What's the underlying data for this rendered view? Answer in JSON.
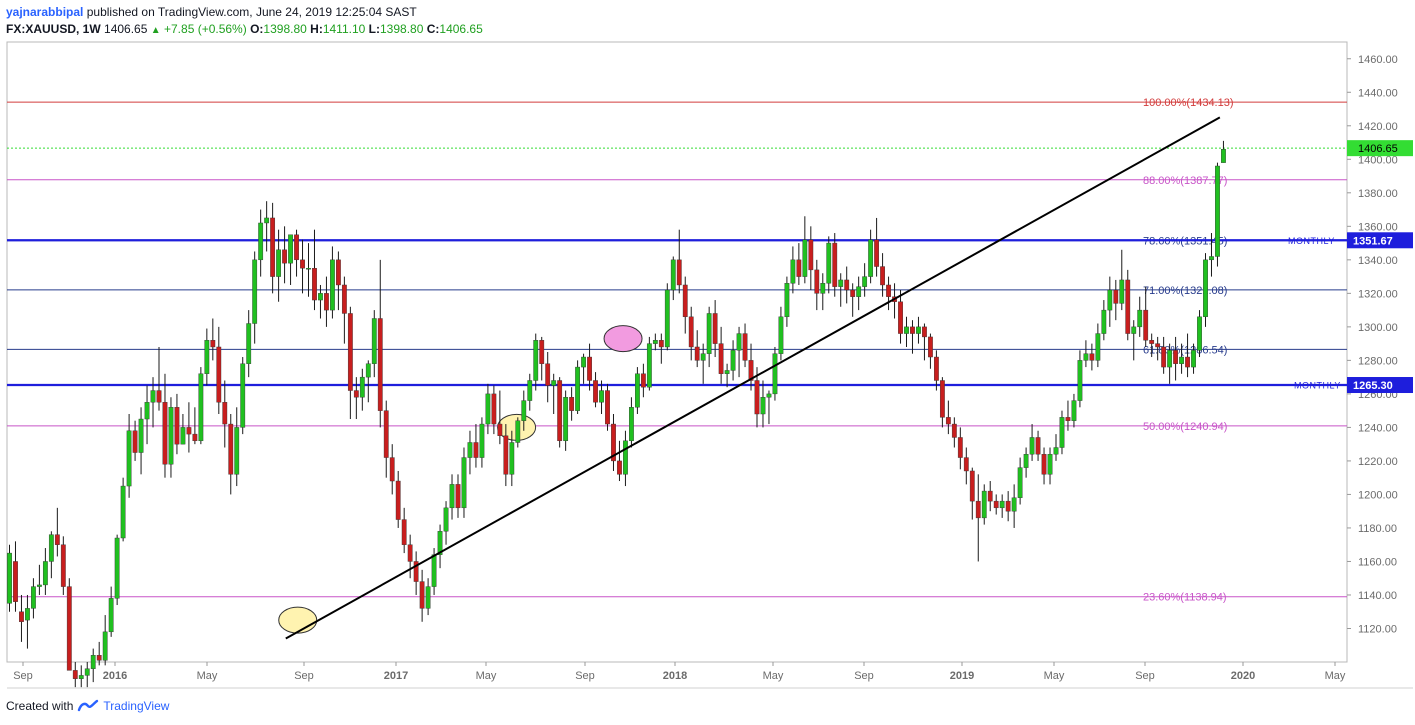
{
  "header": {
    "author": "yajnarabbipal",
    "published_text": "published on TradingView.com, June 24, 2019 12:25:04 SAST",
    "symbol": "FX:XAUUSD, 1W",
    "last": "1406.65",
    "change": "+7.85 (+0.56%)",
    "o_label": "O:",
    "o_value": "1398.80",
    "h_label": "H:",
    "h_value": "1411.10",
    "l_label": "L:",
    "l_value": "1398.80",
    "c_label": "C:",
    "c_value": "1406.65"
  },
  "footer": {
    "created_with": "Created with",
    "brand": "TradingView"
  },
  "colors": {
    "up": "#20c020",
    "down": "#c81e1e",
    "wick": "#1a1a1a",
    "fib_red": "#d23c3c",
    "fib_magenta": "#c855c8",
    "fib_navy": "#283c8c",
    "monthly_blue": "#1e1edc",
    "price_green": "#33dd33",
    "trend": "#000000"
  },
  "chart_data": {
    "type": "candlestick",
    "symbol": "FX:XAUUSD",
    "interval": "1W",
    "ylim": [
      1100,
      1470
    ],
    "y_ticks": [
      1120,
      1140,
      1160,
      1180,
      1200,
      1220,
      1240,
      1260,
      1280,
      1300,
      1320,
      1340,
      1360,
      1380,
      1400,
      1420,
      1440,
      1460
    ],
    "x_ticks": [
      "Sep",
      "2016",
      "May",
      "Sep",
      "2017",
      "May",
      "Sep",
      "2018",
      "May",
      "Sep",
      "2019",
      "May",
      "Sep",
      "2020",
      "May"
    ],
    "fib_levels": [
      {
        "label": "100.00%(1434.13)",
        "value": 1434.13,
        "color": "fib_red"
      },
      {
        "label": "88.00%(1387.77)",
        "value": 1387.77,
        "color": "fib_magenta"
      },
      {
        "label": "78.60%(1351.45)",
        "value": 1351.45,
        "color": "fib_navy"
      },
      {
        "label": "71.00%(1322.08)",
        "value": 1322.08,
        "color": "fib_navy"
      },
      {
        "label": "61.80%(1286.54)",
        "value": 1286.54,
        "color": "fib_navy"
      },
      {
        "label": "50.00%(1240.94)",
        "value": 1240.94,
        "color": "fib_magenta"
      },
      {
        "label": "23.60%(1138.94)",
        "value": 1138.94,
        "color": "fib_magenta"
      }
    ],
    "monthly_levels": [
      {
        "label": "MONTHLY",
        "value": 1351.67,
        "badge": "1351.67"
      },
      {
        "label": "MONTHLY",
        "value": 1265.3,
        "badge": "1265.30"
      }
    ],
    "current_price": {
      "value": 1406.65,
      "label": "1406.65"
    },
    "trendline": {
      "from": {
        "week": 46.2,
        "price": 1114
      },
      "to": {
        "week": 202.4,
        "price": 1425
      }
    },
    "ellipses": [
      {
        "week": 48.2,
        "price": 1125,
        "color": "#fff3b0"
      },
      {
        "week": 84.8,
        "price": 1240,
        "color": "#fff3b0"
      },
      {
        "week": 102.6,
        "price": 1293,
        "color": "#f29be0"
      }
    ],
    "candles": [
      [
        1135,
        1170,
        1130,
        1165
      ],
      [
        1160,
        1172,
        1130,
        1136
      ],
      [
        1130,
        1140,
        1112,
        1124
      ],
      [
        1125,
        1140,
        1108,
        1132
      ],
      [
        1132,
        1150,
        1126,
        1145
      ],
      [
        1145,
        1158,
        1140,
        1146
      ],
      [
        1146,
        1168,
        1140,
        1160
      ],
      [
        1160,
        1178,
        1150,
        1176
      ],
      [
        1176,
        1192,
        1163,
        1170
      ],
      [
        1170,
        1175,
        1140,
        1145
      ],
      [
        1145,
        1150,
        1100,
        1095
      ],
      [
        1095,
        1100,
        1085,
        1090
      ],
      [
        1090,
        1098,
        1085,
        1092
      ],
      [
        1092,
        1100,
        1085,
        1096
      ],
      [
        1096,
        1108,
        1088,
        1104
      ],
      [
        1104,
        1112,
        1098,
        1101
      ],
      [
        1101,
        1128,
        1098,
        1118
      ],
      [
        1118,
        1145,
        1115,
        1138
      ],
      [
        1138,
        1176,
        1134,
        1174
      ],
      [
        1174,
        1210,
        1172,
        1205
      ],
      [
        1205,
        1248,
        1198,
        1238
      ],
      [
        1238,
        1244,
        1220,
        1225
      ],
      [
        1225,
        1252,
        1212,
        1245
      ],
      [
        1245,
        1265,
        1230,
        1255
      ],
      [
        1255,
        1270,
        1240,
        1262
      ],
      [
        1262,
        1288,
        1250,
        1255
      ],
      [
        1255,
        1272,
        1210,
        1218
      ],
      [
        1218,
        1258,
        1210,
        1252
      ],
      [
        1252,
        1260,
        1224,
        1230
      ],
      [
        1230,
        1248,
        1230,
        1240
      ],
      [
        1240,
        1255,
        1225,
        1236
      ],
      [
        1236,
        1252,
        1230,
        1232
      ],
      [
        1232,
        1276,
        1230,
        1272
      ],
      [
        1272,
        1299,
        1265,
        1292
      ],
      [
        1292,
        1305,
        1280,
        1288
      ],
      [
        1288,
        1300,
        1248,
        1255
      ],
      [
        1255,
        1268,
        1228,
        1242
      ],
      [
        1242,
        1248,
        1200,
        1212
      ],
      [
        1212,
        1252,
        1205,
        1240
      ],
      [
        1240,
        1282,
        1236,
        1278
      ],
      [
        1278,
        1310,
        1270,
        1302
      ],
      [
        1302,
        1345,
        1290,
        1340
      ],
      [
        1340,
        1370,
        1330,
        1362
      ],
      [
        1362,
        1375,
        1345,
        1365
      ],
      [
        1365,
        1374,
        1320,
        1330
      ],
      [
        1330,
        1358,
        1315,
        1346
      ],
      [
        1346,
        1360,
        1326,
        1338
      ],
      [
        1338,
        1350,
        1325,
        1355
      ],
      [
        1355,
        1358,
        1330,
        1340
      ],
      [
        1340,
        1352,
        1320,
        1335
      ],
      [
        1335,
        1350,
        1318,
        1335
      ],
      [
        1335,
        1358,
        1310,
        1316
      ],
      [
        1316,
        1325,
        1305,
        1320
      ],
      [
        1320,
        1330,
        1300,
        1310
      ],
      [
        1310,
        1348,
        1305,
        1340
      ],
      [
        1340,
        1345,
        1310,
        1325
      ],
      [
        1325,
        1330,
        1290,
        1308
      ],
      [
        1308,
        1312,
        1245,
        1262
      ],
      [
        1262,
        1270,
        1245,
        1258
      ],
      [
        1258,
        1275,
        1250,
        1270
      ],
      [
        1270,
        1280,
        1255,
        1278
      ],
      [
        1278,
        1310,
        1270,
        1305
      ],
      [
        1305,
        1340,
        1240,
        1250
      ],
      [
        1250,
        1256,
        1210,
        1222
      ],
      [
        1222,
        1230,
        1200,
        1208
      ],
      [
        1208,
        1214,
        1180,
        1185
      ],
      [
        1185,
        1192,
        1165,
        1170
      ],
      [
        1170,
        1176,
        1150,
        1160
      ],
      [
        1160,
        1166,
        1140,
        1148
      ],
      [
        1148,
        1155,
        1124,
        1132
      ],
      [
        1132,
        1150,
        1128,
        1145
      ],
      [
        1145,
        1168,
        1140,
        1164
      ],
      [
        1164,
        1182,
        1156,
        1178
      ],
      [
        1178,
        1196,
        1170,
        1192
      ],
      [
        1192,
        1212,
        1185,
        1206
      ],
      [
        1206,
        1212,
        1186,
        1192
      ],
      [
        1192,
        1228,
        1186,
        1222
      ],
      [
        1222,
        1238,
        1212,
        1231
      ],
      [
        1231,
        1242,
        1216,
        1222
      ],
      [
        1222,
        1246,
        1216,
        1242
      ],
      [
        1242,
        1266,
        1236,
        1260
      ],
      [
        1260,
        1265,
        1236,
        1242
      ],
      [
        1242,
        1262,
        1230,
        1235
      ],
      [
        1235,
        1242,
        1205,
        1212
      ],
      [
        1212,
        1238,
        1205,
        1231
      ],
      [
        1231,
        1246,
        1228,
        1244
      ],
      [
        1244,
        1262,
        1238,
        1256
      ],
      [
        1256,
        1272,
        1250,
        1268
      ],
      [
        1268,
        1296,
        1262,
        1292
      ],
      [
        1292,
        1294,
        1268,
        1278
      ],
      [
        1278,
        1285,
        1255,
        1265
      ],
      [
        1265,
        1272,
        1248,
        1268
      ],
      [
        1268,
        1270,
        1228,
        1232
      ],
      [
        1232,
        1262,
        1226,
        1258
      ],
      [
        1258,
        1264,
        1244,
        1250
      ],
      [
        1250,
        1280,
        1248,
        1276
      ],
      [
        1276,
        1284,
        1266,
        1282
      ],
      [
        1282,
        1290,
        1262,
        1268
      ],
      [
        1268,
        1273,
        1252,
        1255
      ],
      [
        1255,
        1268,
        1248,
        1262
      ],
      [
        1262,
        1266,
        1238,
        1242
      ],
      [
        1242,
        1248,
        1214,
        1220
      ],
      [
        1220,
        1232,
        1208,
        1212
      ],
      [
        1212,
        1238,
        1205,
        1232
      ],
      [
        1232,
        1258,
        1228,
        1252
      ],
      [
        1252,
        1276,
        1248,
        1272
      ],
      [
        1272,
        1278,
        1258,
        1264
      ],
      [
        1264,
        1294,
        1262,
        1290
      ],
      [
        1290,
        1296,
        1286,
        1292
      ],
      [
        1292,
        1296,
        1278,
        1288
      ],
      [
        1288,
        1326,
        1286,
        1322
      ],
      [
        1322,
        1342,
        1316,
        1340
      ],
      [
        1340,
        1358,
        1320,
        1325
      ],
      [
        1325,
        1330,
        1296,
        1306
      ],
      [
        1306,
        1312,
        1280,
        1288
      ],
      [
        1288,
        1298,
        1276,
        1280
      ],
      [
        1280,
        1290,
        1266,
        1284
      ],
      [
        1284,
        1312,
        1276,
        1308
      ],
      [
        1308,
        1316,
        1282,
        1290
      ],
      [
        1290,
        1300,
        1266,
        1272
      ],
      [
        1272,
        1278,
        1264,
        1274
      ],
      [
        1274,
        1292,
        1268,
        1286
      ],
      [
        1286,
        1300,
        1270,
        1296
      ],
      [
        1296,
        1302,
        1276,
        1280
      ],
      [
        1280,
        1290,
        1262,
        1268
      ],
      [
        1268,
        1276,
        1240,
        1248
      ],
      [
        1248,
        1268,
        1240,
        1258
      ],
      [
        1258,
        1262,
        1242,
        1260
      ],
      [
        1260,
        1288,
        1256,
        1284
      ],
      [
        1284,
        1312,
        1280,
        1306
      ],
      [
        1306,
        1330,
        1300,
        1326
      ],
      [
        1326,
        1348,
        1320,
        1340
      ],
      [
        1340,
        1350,
        1325,
        1330
      ],
      [
        1330,
        1366,
        1326,
        1352
      ],
      [
        1352,
        1360,
        1322,
        1334
      ],
      [
        1334,
        1340,
        1310,
        1320
      ],
      [
        1320,
        1332,
        1310,
        1326
      ],
      [
        1326,
        1354,
        1320,
        1350
      ],
      [
        1350,
        1356,
        1318,
        1324
      ],
      [
        1324,
        1332,
        1312,
        1328
      ],
      [
        1328,
        1336,
        1314,
        1322
      ],
      [
        1322,
        1326,
        1306,
        1318
      ],
      [
        1318,
        1330,
        1310,
        1324
      ],
      [
        1324,
        1338,
        1318,
        1330
      ],
      [
        1330,
        1358,
        1326,
        1352
      ],
      [
        1352,
        1365,
        1330,
        1336
      ],
      [
        1336,
        1344,
        1318,
        1325
      ],
      [
        1325,
        1330,
        1310,
        1318
      ],
      [
        1318,
        1326,
        1305,
        1315
      ],
      [
        1315,
        1322,
        1290,
        1296
      ],
      [
        1296,
        1306,
        1288,
        1300
      ],
      [
        1300,
        1304,
        1284,
        1296
      ],
      [
        1296,
        1306,
        1290,
        1300
      ],
      [
        1300,
        1302,
        1280,
        1294
      ],
      [
        1294,
        1296,
        1275,
        1282
      ],
      [
        1282,
        1286,
        1262,
        1268
      ],
      [
        1268,
        1270,
        1240,
        1246
      ],
      [
        1246,
        1256,
        1236,
        1242
      ],
      [
        1242,
        1246,
        1228,
        1234
      ],
      [
        1234,
        1240,
        1215,
        1222
      ],
      [
        1222,
        1228,
        1206,
        1214
      ],
      [
        1214,
        1216,
        1185,
        1196
      ],
      [
        1196,
        1212,
        1160,
        1186
      ],
      [
        1186,
        1206,
        1182,
        1202
      ],
      [
        1202,
        1208,
        1190,
        1196
      ],
      [
        1196,
        1200,
        1188,
        1192
      ],
      [
        1192,
        1200,
        1186,
        1196
      ],
      [
        1196,
        1202,
        1184,
        1190
      ],
      [
        1190,
        1206,
        1180,
        1198
      ],
      [
        1198,
        1222,
        1194,
        1216
      ],
      [
        1216,
        1228,
        1210,
        1224
      ],
      [
        1224,
        1242,
        1220,
        1234
      ],
      [
        1234,
        1238,
        1220,
        1224
      ],
      [
        1224,
        1228,
        1206,
        1212
      ],
      [
        1212,
        1228,
        1206,
        1224
      ],
      [
        1224,
        1236,
        1220,
        1228
      ],
      [
        1228,
        1250,
        1224,
        1246
      ],
      [
        1246,
        1256,
        1238,
        1244
      ],
      [
        1244,
        1260,
        1240,
        1256
      ],
      [
        1256,
        1286,
        1252,
        1280
      ],
      [
        1280,
        1292,
        1276,
        1284
      ],
      [
        1284,
        1290,
        1274,
        1280
      ],
      [
        1280,
        1302,
        1276,
        1296
      ],
      [
        1296,
        1316,
        1292,
        1310
      ],
      [
        1310,
        1330,
        1300,
        1322
      ],
      [
        1322,
        1328,
        1304,
        1314
      ],
      [
        1314,
        1346,
        1310,
        1328
      ],
      [
        1328,
        1334,
        1292,
        1296
      ],
      [
        1296,
        1304,
        1280,
        1300
      ],
      [
        1300,
        1318,
        1294,
        1310
      ],
      [
        1310,
        1324,
        1288,
        1292
      ],
      [
        1292,
        1296,
        1282,
        1290
      ],
      [
        1290,
        1294,
        1280,
        1288
      ],
      [
        1288,
        1294,
        1272,
        1276
      ],
      [
        1276,
        1290,
        1266,
        1286
      ],
      [
        1286,
        1294,
        1268,
        1278
      ],
      [
        1278,
        1290,
        1272,
        1282
      ],
      [
        1282,
        1296,
        1270,
        1276
      ],
      [
        1276,
        1290,
        1272,
        1286
      ],
      [
        1286,
        1310,
        1282,
        1306
      ],
      [
        1306,
        1344,
        1300,
        1340
      ],
      [
        1340,
        1356,
        1330,
        1342
      ],
      [
        1342,
        1398,
        1336,
        1396
      ],
      [
        1398,
        1411,
        1398,
        1406
      ]
    ]
  }
}
